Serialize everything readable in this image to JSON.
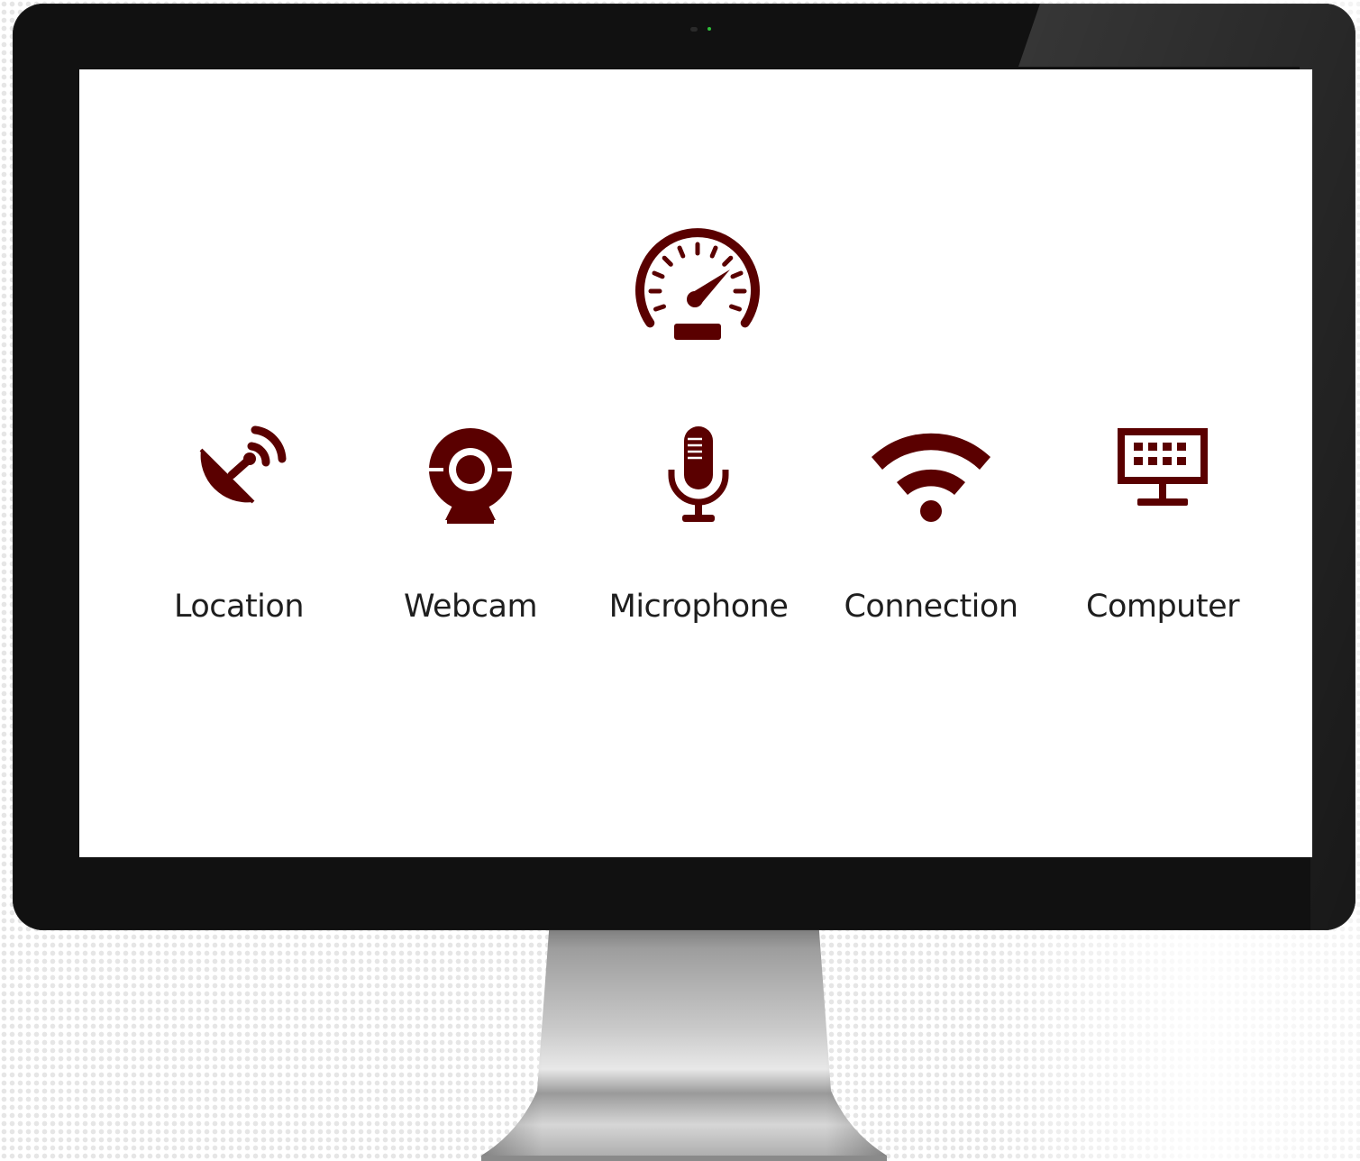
{
  "theme": {
    "accent": "#5a0000",
    "bezel": "#111111",
    "screen": "#ffffff",
    "label_color": "#1e1e1e"
  },
  "header_icon": {
    "icon": "speedometer-icon"
  },
  "tests": [
    {
      "label": "Location",
      "icon": "satellite-dish-icon"
    },
    {
      "label": "Webcam",
      "icon": "webcam-icon"
    },
    {
      "label": "Microphone",
      "icon": "microphone-icon"
    },
    {
      "label": "Connection",
      "icon": "wifi-icon"
    },
    {
      "label": "Computer",
      "icon": "computer-icon"
    }
  ]
}
